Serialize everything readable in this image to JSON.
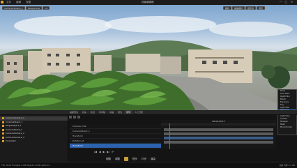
{
  "titlebar": {
    "menu": [
      "文件",
      "编辑",
      "视图"
    ],
    "title": "场景编辑器",
    "window_buttons": [
      "—",
      "□",
      "✕"
    ]
  },
  "viewport": {
    "toolbar_left": [
      "CameraCamera_1",
      "Perspective",
      "Lit"
    ],
    "toolbar_right": [
      "相机",
      "播放相机",
      "摄影机",
      "场景"
    ],
    "context_menu": [
      "Show",
      "Lens Flare",
      "Depth Blur",
      "Bloom",
      "Exposure",
      "Fog",
      "Light Size",
      "Highlight",
      "Volumetric",
      "Light View",
      "Custom",
      "Sharpen",
      "Mask",
      "Monochrome"
    ],
    "context_selected_index": 7
  },
  "outliner": {
    "rows": [
      {
        "label": "CameraCamera_1",
        "selected": true
      },
      {
        "label": "CinemaObject_1",
        "selected": false
      },
      {
        "label": "TargetObject_1",
        "selected": false
      },
      {
        "label": "CameraRootS_1",
        "selected": false
      },
      {
        "label": "CameraCamera_2",
        "selected": false
      },
      {
        "label": "CameraCamera_3",
        "selected": false
      },
      {
        "label": "Cinematic",
        "selected": false
      }
    ]
  },
  "sequencer": {
    "tabs": [
      "画面预设",
      "镜头",
      "轨道",
      "时间轴",
      "动画",
      "属性",
      "序列",
      "人工智能"
    ],
    "active_tab_index": 6,
    "tracks": [
      {
        "label": "Camera Cuts",
        "selected": false
      },
      {
        "label": "CameraObject_1",
        "selected": false
      },
      {
        "label": "Transform",
        "selected": false
      },
      {
        "label": "Rotation_Z",
        "selected": false
      },
      {
        "label": "Transform",
        "selected": true
      }
    ],
    "timecode": "00:00:03:17",
    "transport": [
      "|◀",
      "◀",
      "▶",
      "▶|",
      "⟳"
    ]
  },
  "bottom_nav": [
    "视图",
    "调整",
    "镜头",
    "灯光",
    "渲染"
  ],
  "statusbar": {
    "left": "FPS 30.00  Triangles 5.4M  Objects 1,204  Lights 12",
    "right": "就绪  内存 4.2 GB"
  }
}
